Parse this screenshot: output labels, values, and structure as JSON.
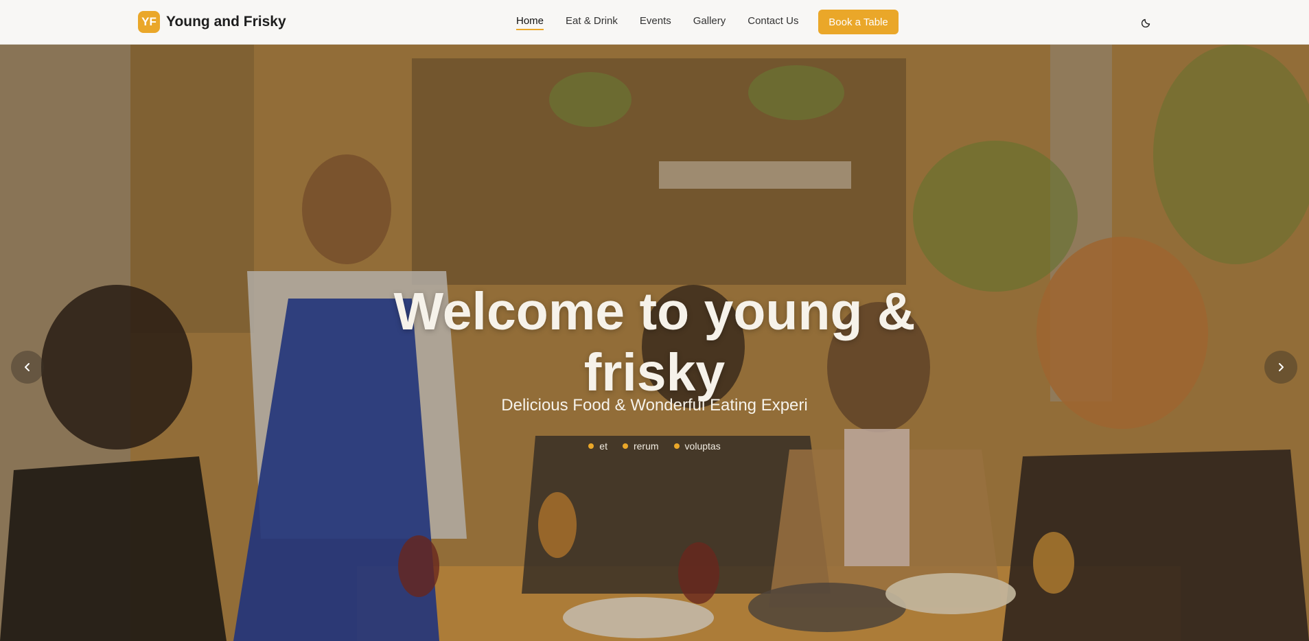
{
  "brand": {
    "badge": "YF",
    "name": "Young and Frisky",
    "accent": "#eaa729"
  },
  "nav": {
    "items": [
      {
        "label": "Home",
        "active": true
      },
      {
        "label": "Eat & Drink"
      },
      {
        "label": "Events"
      },
      {
        "label": "Gallery"
      },
      {
        "label": "Contact Us"
      }
    ],
    "cta": "Book a Table",
    "theme_icon": "moon-icon"
  },
  "hero": {
    "title": "Welcome to young & frisky",
    "subtitle": "Delicious Food & Wonderful Eating Experi",
    "tags": [
      "et",
      "rerum",
      "voluptas"
    ],
    "prev_icon": "chevron-left-icon",
    "next_icon": "chevron-right-icon"
  }
}
